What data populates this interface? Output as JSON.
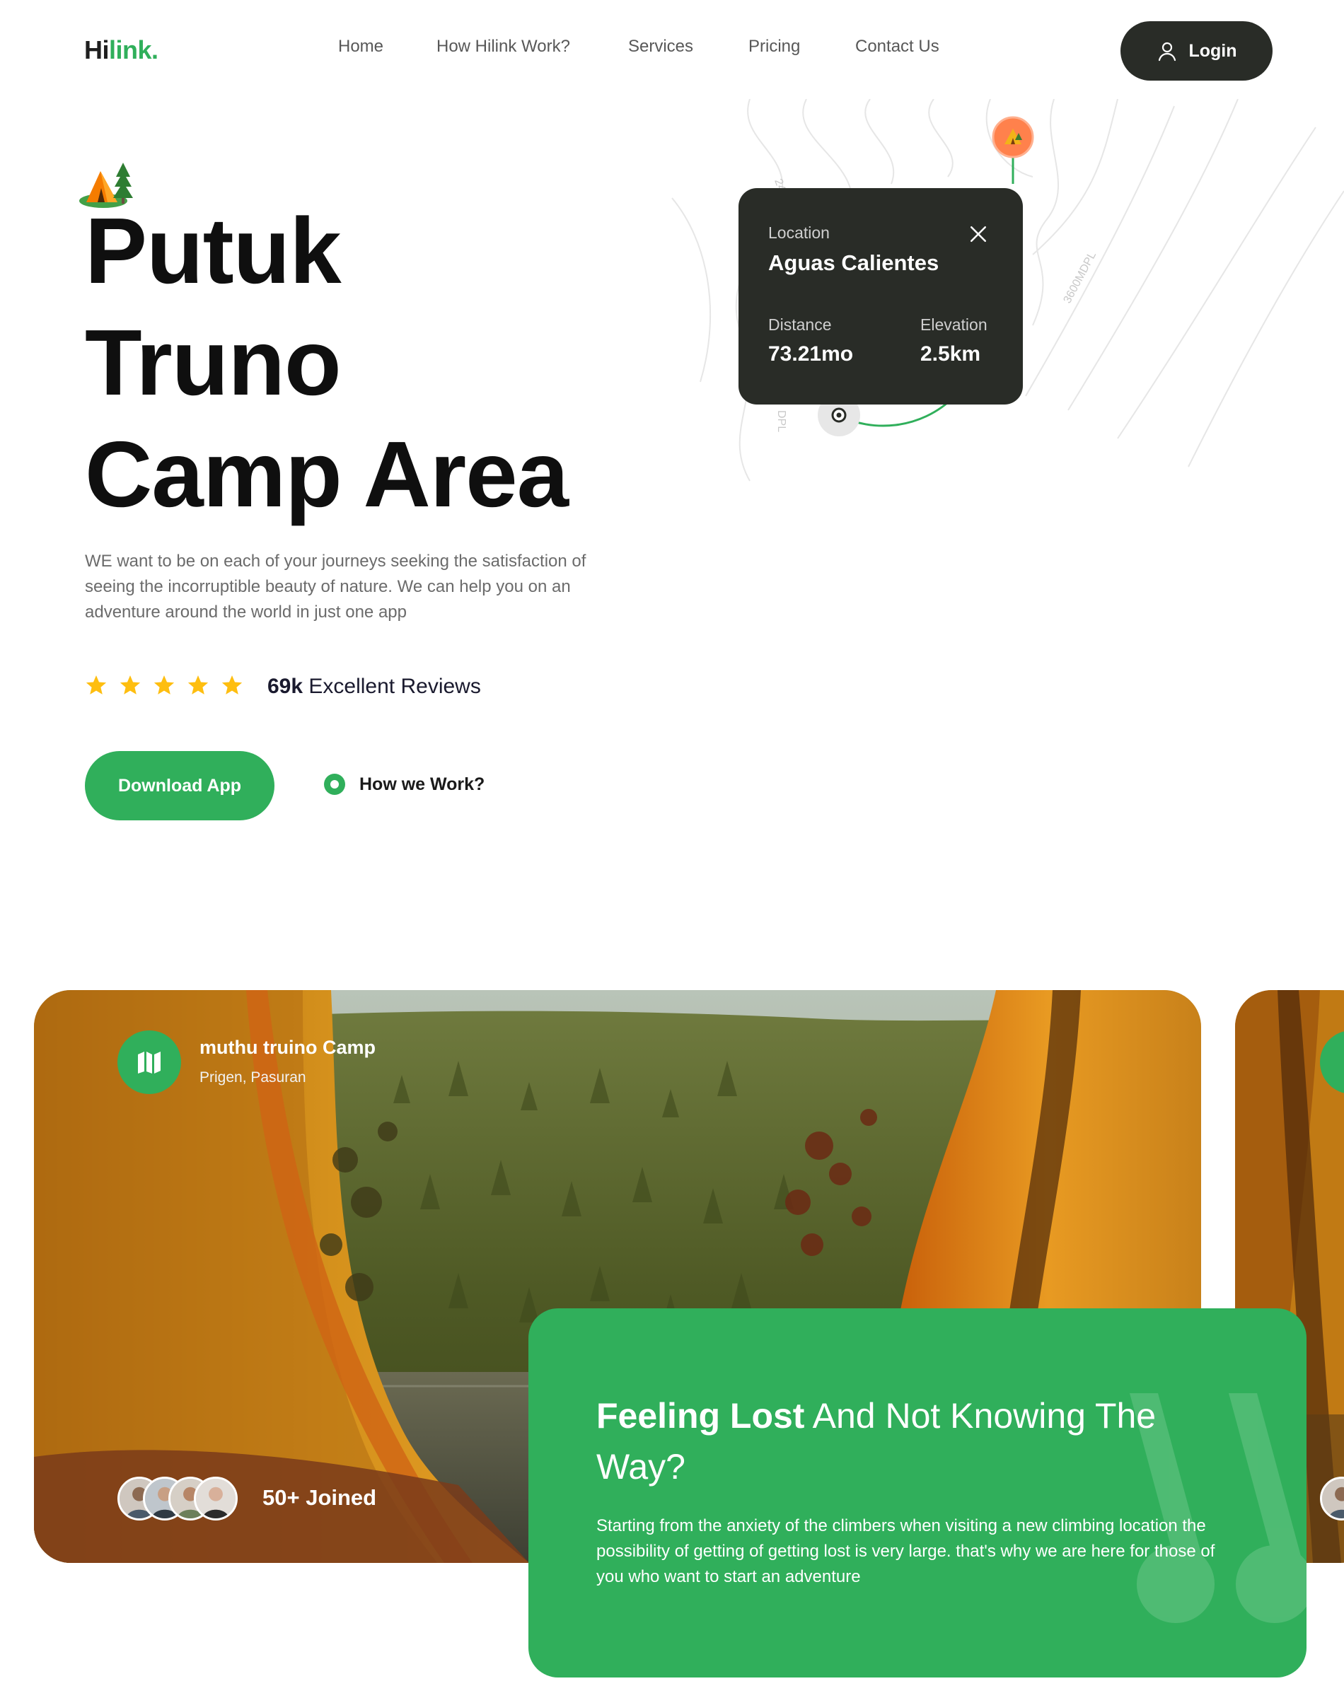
{
  "nav": {
    "logo_main": "Hi",
    "logo_accent": "link.",
    "links": [
      "Home",
      "How Hilink Work?",
      "Services",
      "Pricing",
      "Contact Us"
    ],
    "login_label": "Login"
  },
  "map": {
    "contour_labels": [
      "24",
      "3600MDPL",
      "DPL"
    ],
    "card": {
      "location_label": "Location",
      "location_value": "Aguas Calientes",
      "distance_label": "Distance",
      "distance_value": "73.21mo",
      "elevation_label": "Elevation",
      "elevation_value": "2.5km"
    }
  },
  "hero": {
    "title_lines": [
      "Putuk",
      "Truno",
      "Camp Area"
    ],
    "description": "WE want to be on each of your journeys seeking the satisfaction of seeing the incorruptible beauty of nature. We can help you on an adventure around the world in just one app",
    "rating_stars": 5,
    "reviews_count": "69k",
    "reviews_text": "Excellent Reviews",
    "download_label": "Download App",
    "how_label": "How we Work?"
  },
  "camp_card": {
    "title": "muthu truino Camp",
    "location": "Prigen, Pasuran",
    "joined": "50+ Joined"
  },
  "feature": {
    "heading_bold": "Feeling Lost",
    "heading_rest": "And Not Knowing The Way?",
    "body": "Starting from the anxiety of the climbers when visiting a new climbing location the possibility of getting of getting lost is very large. that's why we are here for those of you who want to start an adventure"
  },
  "colors": {
    "green": "#30af5b",
    "dark": "#292c27",
    "star": "#febe10"
  },
  "icons": [
    "user-icon",
    "close-icon",
    "star-icon",
    "play-icon",
    "folded-map-icon",
    "camp-tent-icon",
    "map-pin-icon"
  ]
}
